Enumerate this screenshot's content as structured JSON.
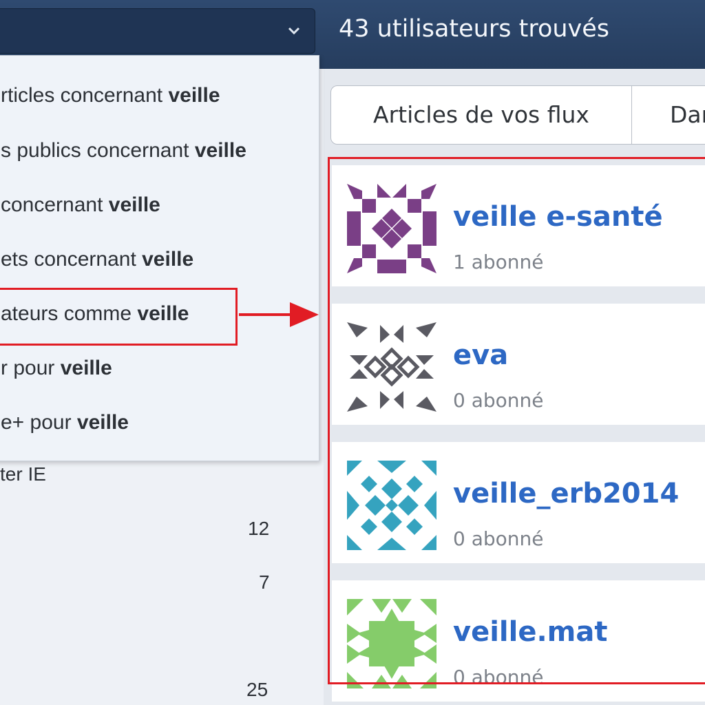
{
  "header": {
    "results_count": "43 utilisateurs trouvés"
  },
  "tabs": [
    "Articles de vos flux",
    "Dar"
  ],
  "menu": {
    "items": [
      {
        "text": "rticles concernant ",
        "keyword": "veille"
      },
      {
        "text": "s publics concernant ",
        "keyword": "veille"
      },
      {
        "text": "concernant ",
        "keyword": "veille"
      },
      {
        "text": "ets concernant ",
        "keyword": "veille"
      },
      {
        "text": "ateurs comme ",
        "keyword": "veille"
      },
      {
        "text": "r pour ",
        "keyword": "veille"
      },
      {
        "text": "e+ pour ",
        "keyword": "veille"
      }
    ]
  },
  "sidebar": {
    "link_fragment": "ter IE",
    "counts": [
      "12",
      "7",
      "25"
    ]
  },
  "users": [
    {
      "name": "veille e-santé",
      "subscribers": "1 abonné",
      "avatar_color": "#7a3f86"
    },
    {
      "name": "eva",
      "subscribers": "0 abonné",
      "avatar_color": "#5a5a62"
    },
    {
      "name": "veille_erb2014",
      "subscribers": "0 abonné",
      "avatar_color": "#35a3bf"
    },
    {
      "name": "veille.mat",
      "subscribers": "0 abonné",
      "avatar_color": "#85cc6a"
    }
  ],
  "colors": {
    "header_bg": "#2f4a70",
    "link_blue": "#2d68c4",
    "highlight_red": "#e11c24"
  }
}
